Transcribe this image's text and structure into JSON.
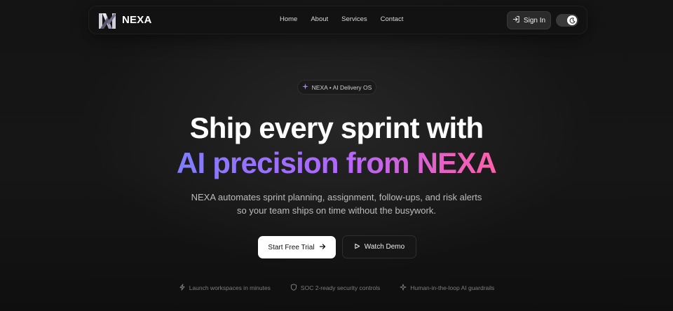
{
  "brand": {
    "name": "NEXA"
  },
  "nav": {
    "links": [
      "Home",
      "About",
      "Services",
      "Contact"
    ],
    "signin_label": "Sign In"
  },
  "hero": {
    "badge": "NEXA • AI Delivery OS",
    "headline_line1": "Ship every sprint with",
    "headline_line2": "AI precision from NEXA",
    "subtitle_line1": "NEXA automates sprint planning, assignment, follow-ups, and risk alerts",
    "subtitle_line2": "so your team ships on time without the busywork.",
    "primary_cta": "Start Free Trial",
    "secondary_cta": "Watch Demo"
  },
  "features": [
    {
      "icon": "bolt-icon",
      "label": "Launch workspaces in minutes"
    },
    {
      "icon": "shield-icon",
      "label": "SOC 2-ready security controls"
    },
    {
      "icon": "sparkle-icon",
      "label": "Human-in-the-loop AI guardrails"
    }
  ],
  "colors": {
    "background": "#141414",
    "gradient_start": "#7f7dff",
    "gradient_mid": "#b066ff",
    "gradient_end": "#ff5fa8",
    "badge_sparkle": "#a77bff"
  }
}
